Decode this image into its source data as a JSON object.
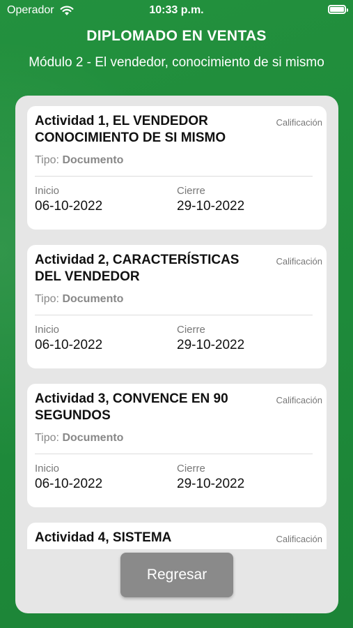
{
  "status_bar": {
    "carrier": "Operador",
    "time": "10:33 p.m."
  },
  "header": {
    "title": "DIPLOMADO EN VENTAS",
    "subtitle": "Módulo 2 - El vendedor, conocimiento de si mismo"
  },
  "activities": [
    {
      "title": "Actividad 1, EL VENDEDOR CONOCIMIENTO DE SI MISMO",
      "grade_label": "Calificación",
      "type_label": "Tipo:",
      "type_value": "Documento",
      "start_label": "Inicio",
      "start_date": "06-10-2022",
      "end_label": "Cierre",
      "end_date": "29-10-2022"
    },
    {
      "title": "Actividad 2, CARACTERÍSTICAS DEL VENDEDOR",
      "grade_label": "Calificación",
      "type_label": "Tipo:",
      "type_value": "Documento",
      "start_label": "Inicio",
      "start_date": "06-10-2022",
      "end_label": "Cierre",
      "end_date": "29-10-2022"
    },
    {
      "title": "Actividad 3, CONVENCE EN 90 SEGUNDOS",
      "grade_label": "Calificación",
      "type_label": "Tipo:",
      "type_value": "Documento",
      "start_label": "Inicio",
      "start_date": "06-10-2022",
      "end_label": "Cierre",
      "end_date": "29-10-2022"
    },
    {
      "title": "Actividad 4, SISTEMA",
      "grade_label": "Calificación"
    }
  ],
  "footer": {
    "back_label": "Regresar"
  },
  "colors": {
    "background": "#1f8a3a",
    "panel": "#e6e6e6",
    "button": "#8a8a8a"
  }
}
